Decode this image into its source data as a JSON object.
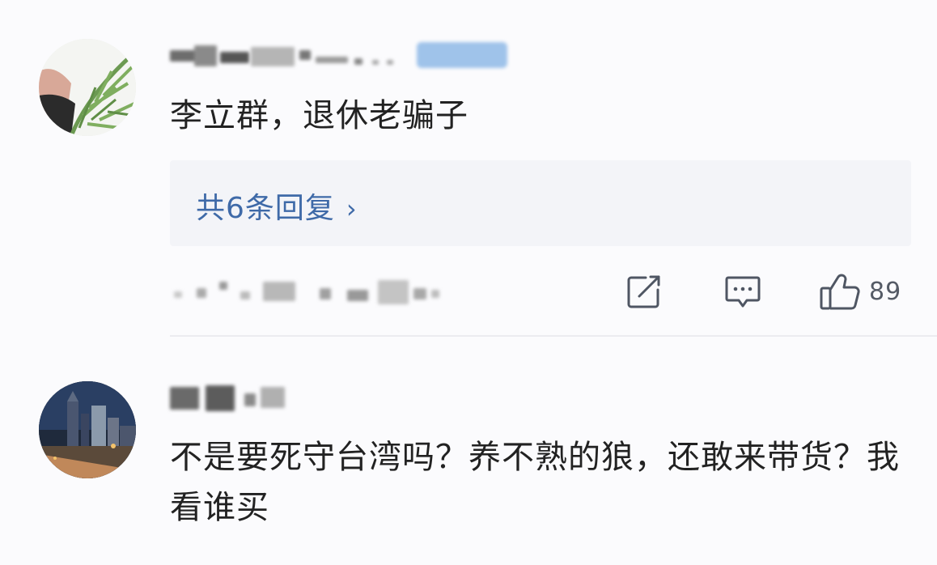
{
  "comments": [
    {
      "avatar_icon": "avatar-plant-photo",
      "text": "李立群，退休老骗子",
      "reply_link": "共6条回复",
      "reply_chevron": "›",
      "actions": {
        "edit_icon": "share-edit-icon",
        "comment_icon": "comment-bubble-icon",
        "like_icon": "thumbs-up-icon",
        "like_count": "89"
      }
    },
    {
      "avatar_icon": "avatar-city-night-photo",
      "text": "不是要死守台湾吗？养不熟的狼，还敢来带货？我看谁买"
    }
  ],
  "colors": {
    "link": "#3f6aa8",
    "text": "#222222",
    "icon": "#4f5663",
    "reply_bg": "#f3f4f8"
  }
}
